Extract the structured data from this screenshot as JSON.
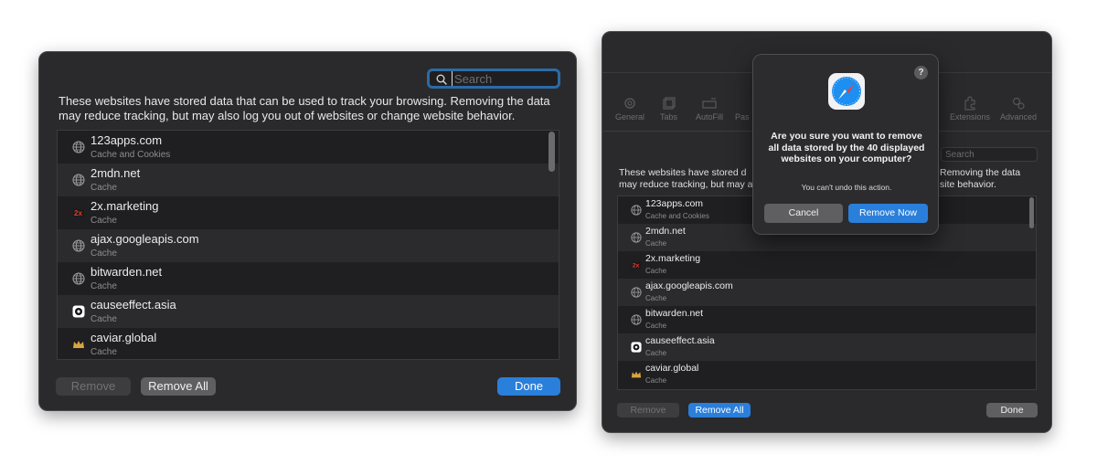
{
  "left_window": {
    "search": {
      "placeholder": "Search",
      "value": ""
    },
    "description": "These websites have stored data that can be used to track your browsing. Removing the data may reduce tracking, but may also log you out of websites or change website behavior.",
    "sites": [
      {
        "name": "123apps.com",
        "type": "Cache and Cookies",
        "icon": "globe-icon"
      },
      {
        "name": "2mdn.net",
        "type": "Cache",
        "icon": "globe-icon"
      },
      {
        "name": "2x.marketing",
        "type": "Cache",
        "icon": "2x-favicon"
      },
      {
        "name": "ajax.googleapis.com",
        "type": "Cache",
        "icon": "globe-icon"
      },
      {
        "name": "bitwarden.net",
        "type": "Cache",
        "icon": "globe-icon"
      },
      {
        "name": "causeeffect.asia",
        "type": "Cache",
        "icon": "causeeffect-favicon"
      },
      {
        "name": "caviar.global",
        "type": "Cache",
        "icon": "crown-favicon"
      }
    ],
    "buttons": {
      "remove": "Remove",
      "remove_all": "Remove All",
      "done": "Done"
    }
  },
  "right_window": {
    "toolbar": [
      "General",
      "Tabs",
      "AutoFill",
      "Pas",
      "Extensions",
      "Advanced"
    ],
    "search": {
      "placeholder": "Search",
      "value": ""
    },
    "description_left": [
      "These websites have stored d",
      "may reduce tracking, but may a"
    ],
    "description_right": [
      "Removing the data",
      "site behavior."
    ],
    "sites": [
      {
        "name": "123apps.com",
        "type": "Cache and Cookies",
        "icon": "globe-icon"
      },
      {
        "name": "2mdn.net",
        "type": "Cache",
        "icon": "globe-icon"
      },
      {
        "name": "2x.marketing",
        "type": "Cache",
        "icon": "2x-favicon"
      },
      {
        "name": "ajax.googleapis.com",
        "type": "Cache",
        "icon": "globe-icon"
      },
      {
        "name": "bitwarden.net",
        "type": "Cache",
        "icon": "globe-icon"
      },
      {
        "name": "causeeffect.asia",
        "type": "Cache",
        "icon": "causeeffect-favicon"
      },
      {
        "name": "caviar.global",
        "type": "Cache",
        "icon": "crown-favicon"
      }
    ],
    "buttons": {
      "remove": "Remove",
      "remove_all": "Remove All",
      "done": "Done"
    },
    "alert": {
      "help": "?",
      "title": "Are you sure you want to remove all data stored by the 40 displayed websites on your computer?",
      "message": "You can't undo this action.",
      "cancel": "Cancel",
      "confirm": "Remove Now"
    }
  },
  "colors": {
    "window_bg": "#2a2a2c",
    "list_bg": "#1f1f21",
    "accent": "#2a7fdb",
    "button_gray": "#5f5f62"
  }
}
